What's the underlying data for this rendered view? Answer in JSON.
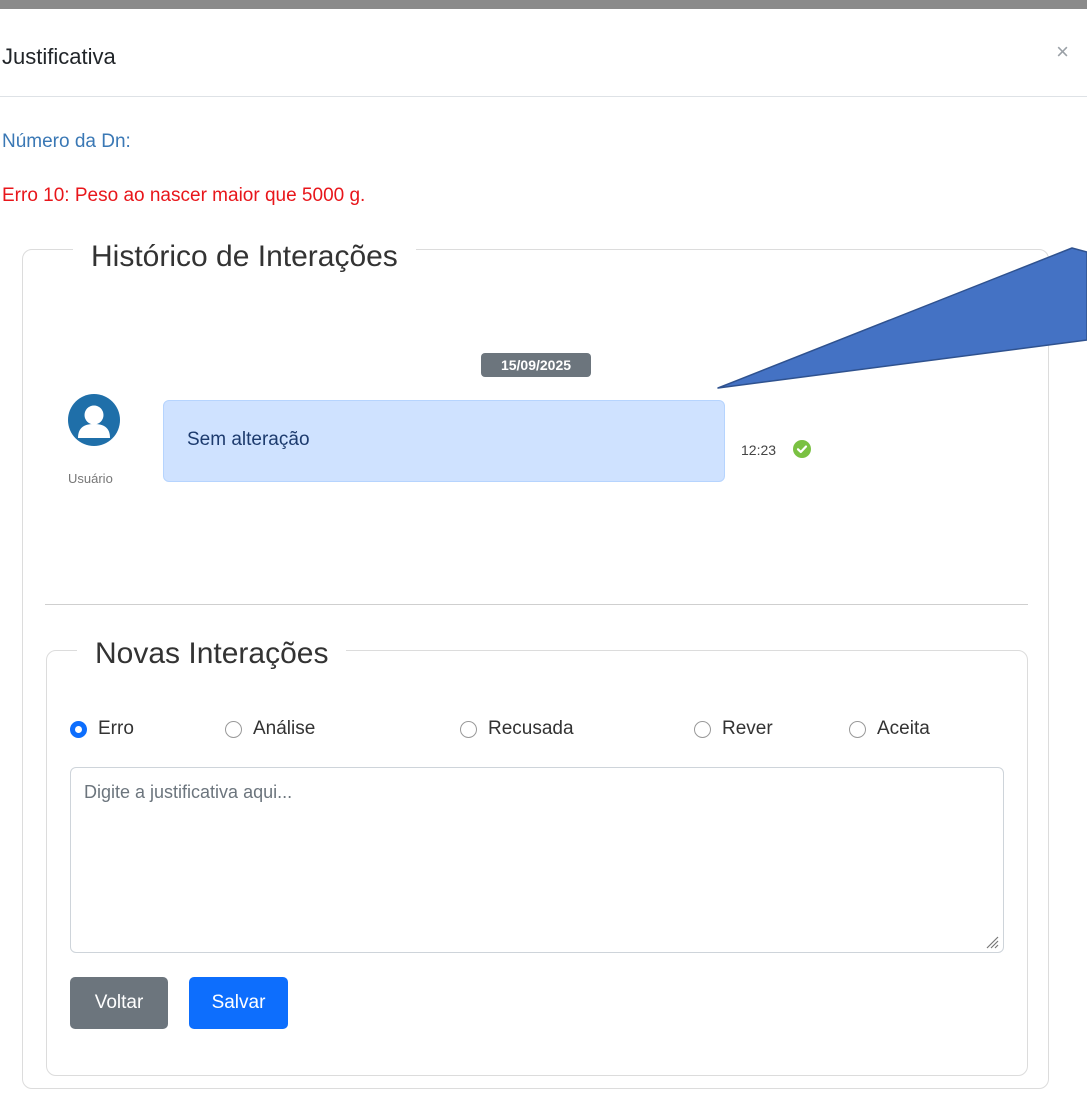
{
  "modal": {
    "title": "Justificativa",
    "close_label": "×"
  },
  "dn_label": "Número da Dn:",
  "error_message": "Erro 10: Peso ao nascer maior que 5000 g.",
  "history": {
    "legend": "Histórico de Interações",
    "date_badge": "15/09/2025",
    "message": {
      "user_label": "Usuário",
      "text": "Sem alteração",
      "time": "12:23",
      "status_icon": "check-circle-icon"
    }
  },
  "new_interactions": {
    "legend": "Novas Interações",
    "options": [
      "Erro",
      "Análise",
      "Recusada",
      "Rever",
      "Aceita"
    ],
    "selected": "Erro",
    "textarea_placeholder": "Digite a justificativa aqui...",
    "textarea_value": "",
    "back_label": "Voltar",
    "save_label": "Salvar"
  },
  "colors": {
    "primary": "#0d6efd",
    "secondary": "#6c757d",
    "error": "#e8161b",
    "label": "#3a78b5",
    "bubble": "#cfe2ff",
    "check": "#7ac142",
    "annotation_arrow": "#4472c4"
  }
}
